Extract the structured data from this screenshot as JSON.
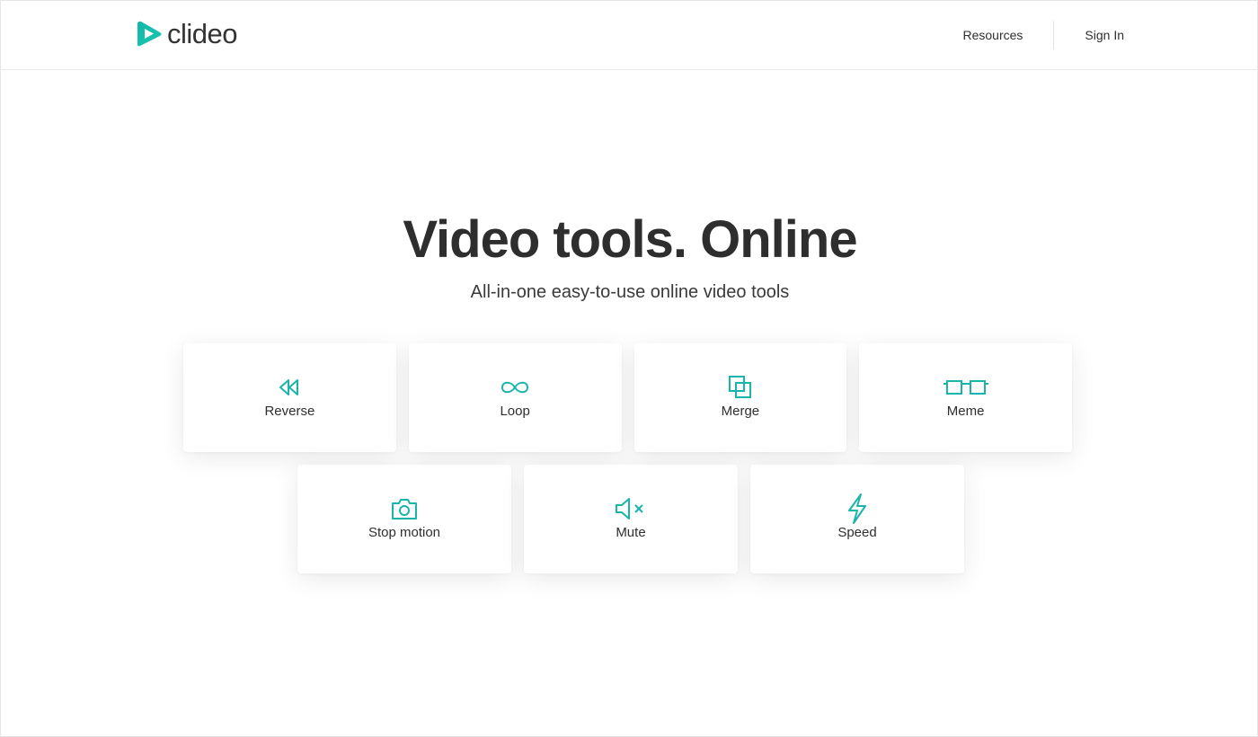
{
  "brand": {
    "name": "clideo",
    "accent": "#19b5ac"
  },
  "nav": {
    "resources": "Resources",
    "sign_in": "Sign In"
  },
  "hero": {
    "title": "Video tools. Online",
    "subtitle": "All-in-one easy-to-use online video tools"
  },
  "tools": [
    {
      "label": "Reverse",
      "icon": "rewind-icon"
    },
    {
      "label": "Loop",
      "icon": "infinity-icon"
    },
    {
      "label": "Merge",
      "icon": "overlapping-squares-icon"
    },
    {
      "label": "Meme",
      "icon": "glasses-icon"
    },
    {
      "label": "Stop motion",
      "icon": "camera-icon"
    },
    {
      "label": "Mute",
      "icon": "speaker-mute-icon"
    },
    {
      "label": "Speed",
      "icon": "lightning-icon"
    }
  ]
}
